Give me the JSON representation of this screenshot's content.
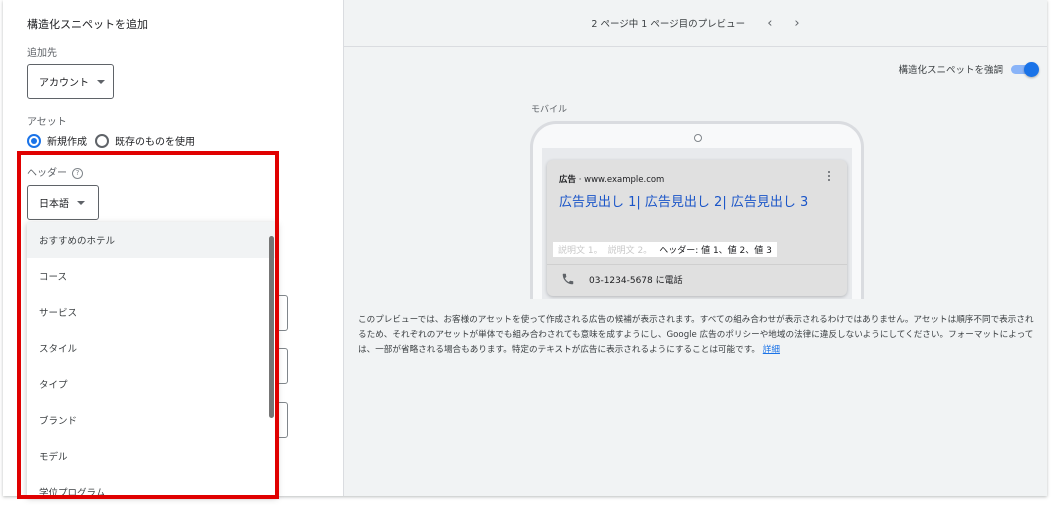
{
  "left_panel": {
    "title": "構造化スニペットを追加",
    "add_to_label": "追加先",
    "add_to_value": "アカウント",
    "asset_label": "アセット",
    "radio_new": "新規作成",
    "radio_existing": "既存のものを使用",
    "header_label": "ヘッダー",
    "help_icon_glyph": "?",
    "language_value": "日本語",
    "header_options": [
      "おすすめのホテル",
      "コース",
      "サービス",
      "スタイル",
      "タイプ",
      "ブランド",
      "モデル",
      "学位プログラム"
    ]
  },
  "preview": {
    "page_indicator": "2 ページ中 1 ページ目のプレビュー",
    "prev_arrow": "‹",
    "next_arrow": "›",
    "toggle_label": "構造化スニペットを強調",
    "toggle_on": true,
    "mobile_label": "モバイル",
    "ad_badge": "広告",
    "ad_url": "· www.example.com",
    "ad_headline": "広告見出し 1| 広告見出し 2| 広告見出し 3",
    "ad_desc_1": "説明文 1。",
    "ad_desc_2": "説明文 2。",
    "ad_snippet": "ヘッダー: 値 1、値 2、値 3",
    "ad_phone": "03-1234-5678 に電話",
    "disclaimer": "このプレビューでは、お客様のアセットを使って作成される広告の候補が表示されます。すべての組み合わせが表示されるわけではありません。アセットは順序不同で表示されるため、それぞれのアセットが単体でも組み合わされても意味を成すようにし、Google 広告のポリシーや地域の法律に違反しないようにしてください。フォーマットによっては、一部が省略される場合もあります。特定のテキストが広告に表示されるようにすることは可能です。",
    "details_link": "詳細"
  },
  "colors": {
    "accent": "#1a73e8",
    "highlight_box": "#e00000",
    "headline": "#1a55c8"
  }
}
